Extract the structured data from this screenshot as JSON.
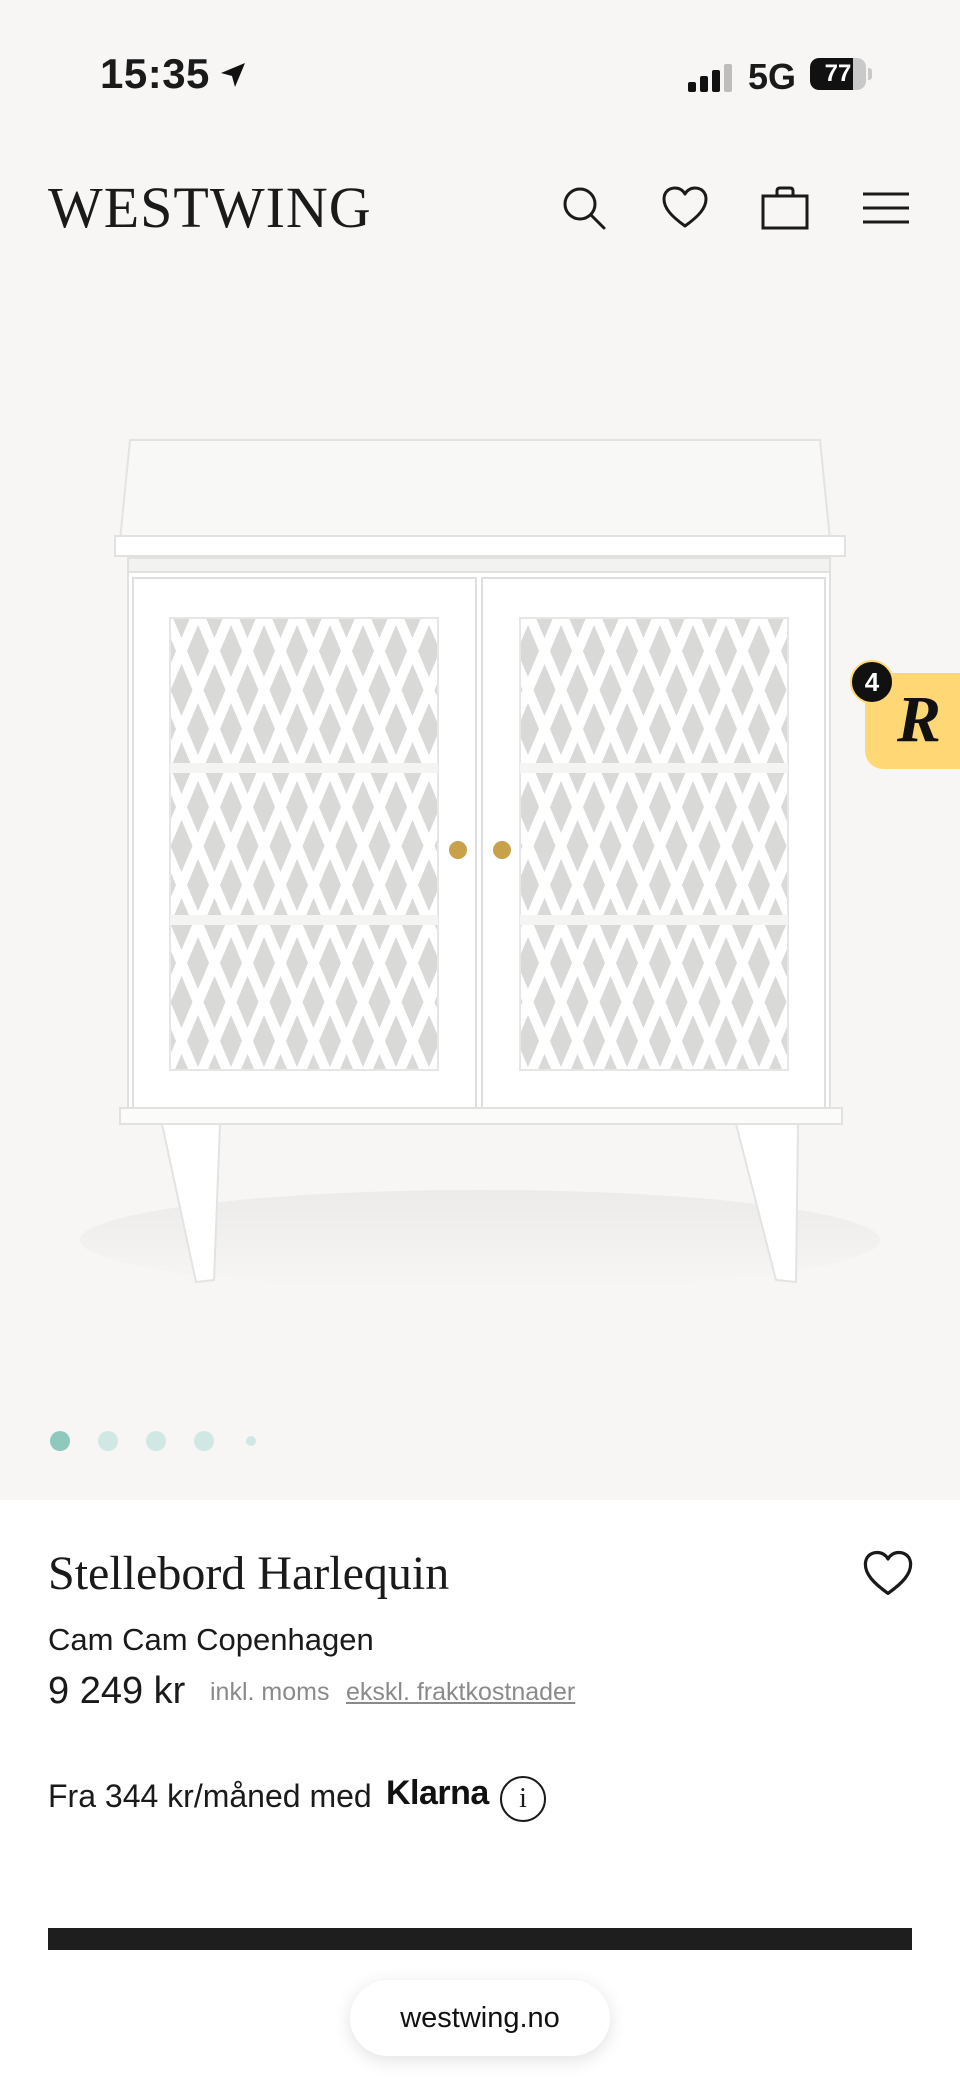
{
  "status_bar": {
    "time": "15:35",
    "network": "5G",
    "battery_percent": "77",
    "battery_level": 0.77
  },
  "header": {
    "logo": "WESTWING",
    "icons": [
      "search-icon",
      "heart-icon",
      "bag-icon",
      "menu-icon"
    ]
  },
  "gallery": {
    "image_alt": "white cabinet with harlequin-pattern glass doors",
    "dot_count": 5,
    "active_index": 0,
    "accent_active": "#8fc9be",
    "accent_inactive": "#cfe8e3"
  },
  "floating_badge": {
    "letter": "R",
    "count": "4",
    "color": "#ffd775"
  },
  "product": {
    "title": "Stellebord Harlequin",
    "brand": "Cam Cam Copenhagen",
    "price": "9 249 kr",
    "vat_note": "inkl. moms",
    "shipping_note": "ekskl. fraktkostnader"
  },
  "financing": {
    "text": "Fra 344 kr/måned med",
    "provider": "Klarna",
    "info_glyph": "i"
  },
  "browser": {
    "url": "westwing.no"
  }
}
